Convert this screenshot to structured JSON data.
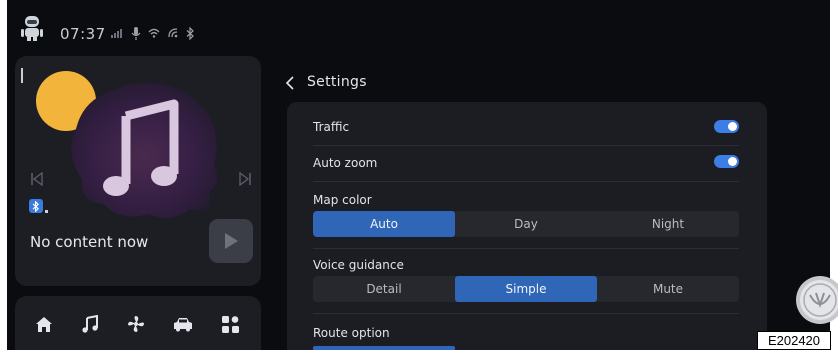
{
  "status_bar": {
    "time": "07:37",
    "icons": [
      "robot-avatar-icon",
      "signal-icon",
      "mic-icon",
      "wifi-icon",
      "nfc-icon",
      "bluetooth-icon"
    ]
  },
  "media": {
    "empty_message": "No content now",
    "source_icon": "bluetooth-icon",
    "controls": [
      "previous-track-icon",
      "next-track-icon",
      "play-icon"
    ]
  },
  "dock": {
    "items": [
      "home-icon",
      "music-icon",
      "fan-icon",
      "car-icon",
      "apps-grid-icon"
    ]
  },
  "settings": {
    "back_icon": "chevron-left-icon",
    "title": "Settings",
    "traffic": {
      "label": "Traffic",
      "enabled": true
    },
    "auto_zoom": {
      "label": "Auto zoom",
      "enabled": true
    },
    "map_color": {
      "label": "Map color",
      "options": [
        "Auto",
        "Day",
        "Night"
      ],
      "selected": "Auto"
    },
    "voice_guidance": {
      "label": "Voice guidance",
      "options": [
        "Detail",
        "Simple",
        "Mute"
      ],
      "selected": "Simple"
    },
    "route_option": {
      "label": "Route option"
    }
  },
  "figure_ref": "E202420",
  "colors": {
    "background": "#0b0c0f",
    "panel": "#1b1d22",
    "accent": "#2f66b8",
    "toggle_on": "#3d7ee6",
    "sun": "#f2b43b"
  }
}
